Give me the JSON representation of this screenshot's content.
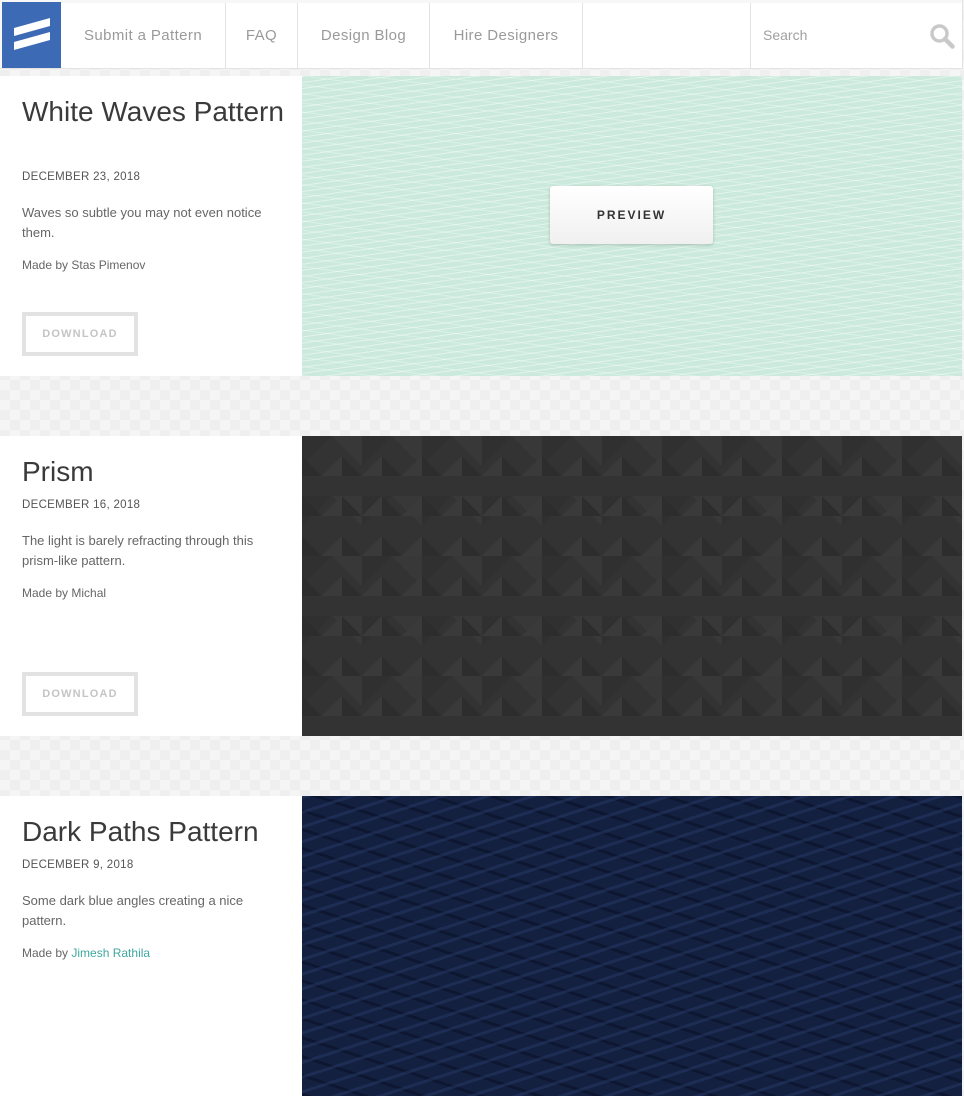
{
  "header": {
    "nav": [
      {
        "label": "Submit a Pattern"
      },
      {
        "label": "FAQ"
      },
      {
        "label": "Design Blog"
      },
      {
        "label": "Hire Designers"
      }
    ],
    "search": {
      "placeholder": "Search"
    }
  },
  "patterns": [
    {
      "title": "White Waves Pattern",
      "date": "DECEMBER 23, 2018",
      "description": "Waves so subtle you may not even notice them.",
      "author_prefix": "Made by",
      "author": "Stas Pimenov",
      "download_label": "DOWNLOAD",
      "preview_label": "PREVIEW",
      "preview_color": "#cbeadd"
    },
    {
      "title": "Prism",
      "date": "DECEMBER 16, 2018",
      "description": "The light is barely refracting through this prism-like pattern.",
      "author_prefix": "Made by",
      "author": "Michal",
      "download_label": "DOWNLOAD",
      "preview_color": "#333333"
    },
    {
      "title": "Dark Paths Pattern",
      "date": "DECEMBER 9, 2018",
      "description": "Some dark blue angles creating a nice pattern.",
      "author_prefix": "Made by",
      "author": "Jimesh Rathila",
      "preview_color": "#14203f"
    }
  ],
  "colors": {
    "brand": "#3d6ab5",
    "link": "#3fa7a0"
  }
}
